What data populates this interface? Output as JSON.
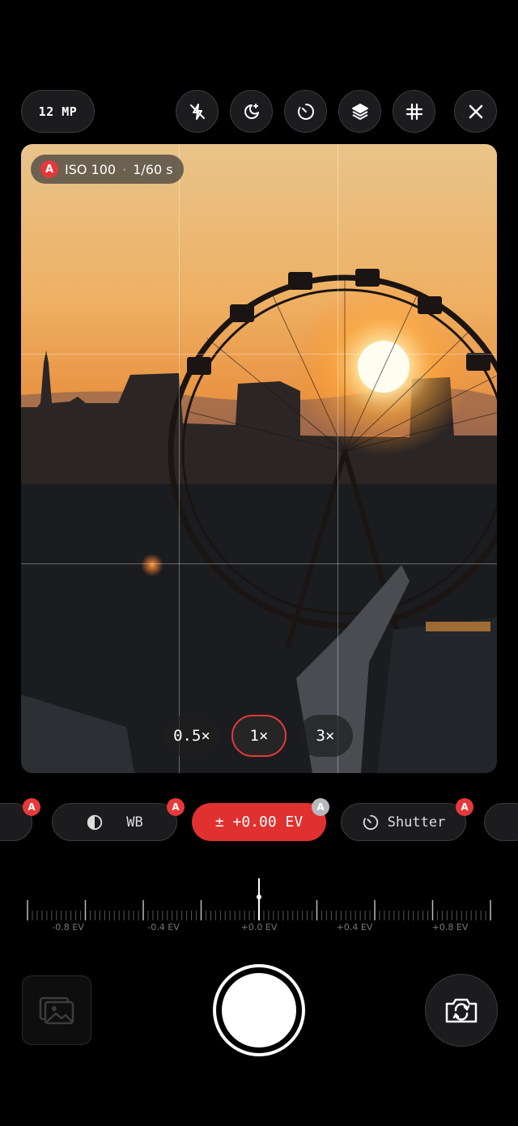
{
  "topbar": {
    "resolution_label": "12 MP",
    "icons": [
      "flash-off-icon",
      "night-mode-icon",
      "timer-icon",
      "layers-icon",
      "grid-icon",
      "close-icon"
    ]
  },
  "viewfinder": {
    "exposure": {
      "auto_badge": "A",
      "iso": "ISO 100",
      "separator": "·",
      "shutter": "1/60 s"
    },
    "zoom": [
      {
        "label": "0.5×",
        "active": false
      },
      {
        "label": "1×",
        "active": true
      },
      {
        "label": "3×",
        "active": false
      }
    ]
  },
  "controls": {
    "wb_label": "WB",
    "ev_label": "± +0.00 EV",
    "shutter_label": "Shutter",
    "auto_badge": "A"
  },
  "ev_ruler": {
    "labels": [
      "-0.8 EV",
      "-0.4 EV",
      "+0.0 EV",
      "+0.4 EV",
      "+0.8 EV"
    ],
    "current_value": 0.0
  },
  "bottom": {
    "icons": [
      "gallery-icon",
      "shutter-button",
      "flip-camera-icon"
    ]
  },
  "colors": {
    "accent": "#e5393a",
    "background": "#000000"
  }
}
